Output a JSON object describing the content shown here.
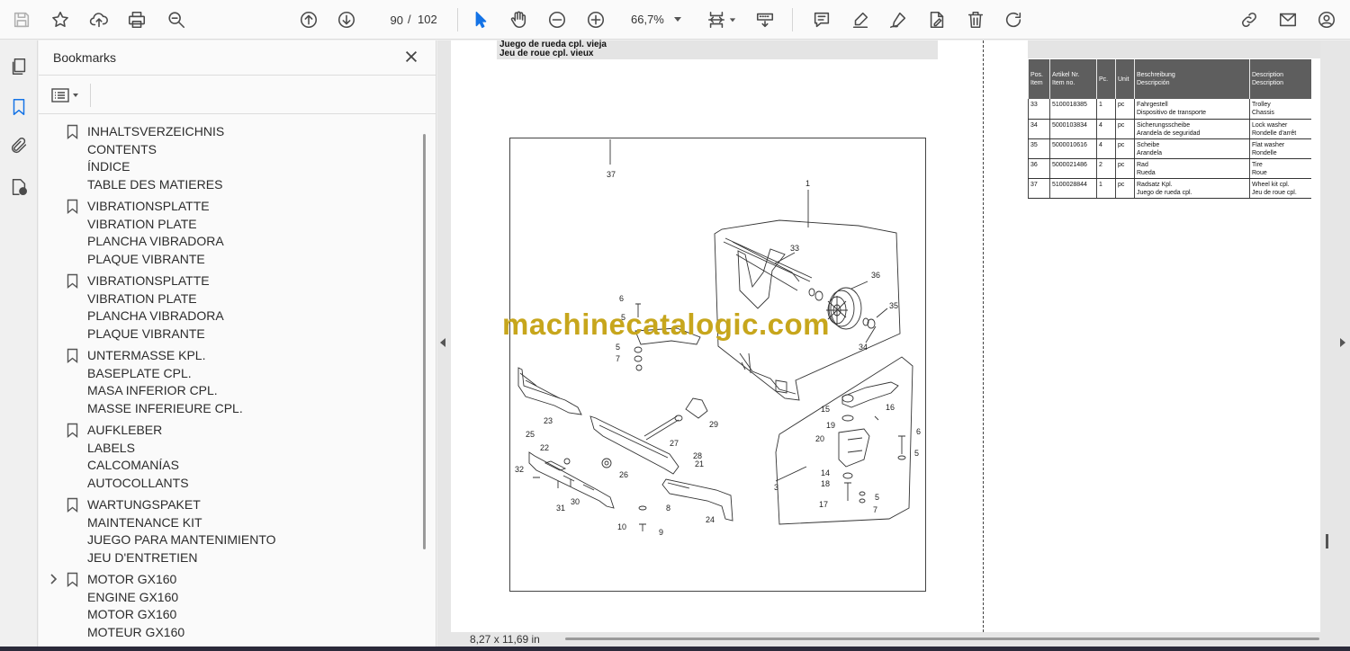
{
  "toolbar": {
    "page_current": "90",
    "page_separator": "/",
    "page_total": "102",
    "zoom": "66,7%"
  },
  "bookmarks": {
    "title": "Bookmarks",
    "groups": [
      {
        "lines": [
          "INHALTSVERZEICHNIS",
          "CONTENTS",
          "ÍNDICE",
          "TABLE DES MATIERES"
        ],
        "expandable": false
      },
      {
        "lines": [
          "VIBRATIONSPLATTE",
          "VIBRATION PLATE",
          "PLANCHA VIBRADORA",
          "PLAQUE VIBRANTE"
        ],
        "expandable": false
      },
      {
        "lines": [
          "VIBRATIONSPLATTE",
          "VIBRATION PLATE",
          "PLANCHA VIBRADORA",
          "PLAQUE VIBRANTE"
        ],
        "expandable": false
      },
      {
        "lines": [
          "UNTERMASSE KPL.",
          "BASEPLATE CPL.",
          "MASA INFERIOR CPL.",
          "MASSE INFERIEURE CPL."
        ],
        "expandable": false
      },
      {
        "lines": [
          "AUFKLEBER",
          "LABELS",
          "CALCOMANÍAS",
          "AUTOCOLLANTS"
        ],
        "expandable": false
      },
      {
        "lines": [
          "WARTUNGSPAKET",
          "MAINTENANCE KIT",
          "JUEGO PARA MANTENIMIENTO",
          "JEU D'ENTRETIEN"
        ],
        "expandable": false
      },
      {
        "lines": [
          "MOTOR GX160",
          "ENGINE GX160",
          "MOTOR GX160",
          "MOTEUR GX160"
        ],
        "expandable": true
      }
    ]
  },
  "document": {
    "header_line1": "Juego de rueda cpl. vieja",
    "header_line2": "Jeu de roue cpl. vieux",
    "watermark": "machinecatalogic.com",
    "page_size": "8,27 x 11,69 in",
    "diagram_labels": [
      "37",
      "1",
      "33",
      "36",
      "35",
      "34",
      "6",
      "5",
      "5",
      "7",
      "23",
      "25",
      "22",
      "32",
      "31",
      "30",
      "26",
      "21",
      "27",
      "28",
      "29",
      "8",
      "24",
      "10",
      "9",
      "3",
      "15",
      "19",
      "16",
      "20",
      "14",
      "18",
      "17",
      "6",
      "5",
      "5",
      "7"
    ],
    "parts_table": {
      "headers": [
        [
          "Pos.",
          "Item"
        ],
        [
          "Artikel Nr.",
          "Item no."
        ],
        [
          "Pc."
        ],
        [
          "Unit"
        ],
        [
          "Beschreibung",
          "Descripción"
        ],
        [
          "Description",
          "Description"
        ]
      ],
      "rows": [
        {
          "pos": "33",
          "item": "5100018385",
          "pc": "1",
          "unit": "pc",
          "desc1": "Fahrgestell",
          "desc2": "Dispositivo de transporte",
          "desc3": "Trolley",
          "desc4": "Chassis"
        },
        {
          "pos": "34",
          "item": "5000103834",
          "pc": "4",
          "unit": "pc",
          "desc1": "Sicherungsscheibe",
          "desc2": "Arandela de seguridad",
          "desc3": "Lock washer",
          "desc4": "Rondelle d'arrêt"
        },
        {
          "pos": "35",
          "item": "5000010616",
          "pc": "4",
          "unit": "pc",
          "desc1": "Scheibe",
          "desc2": "Arandela",
          "desc3": "Flat washer",
          "desc4": "Rondelle"
        },
        {
          "pos": "36",
          "item": "5000021486",
          "pc": "2",
          "unit": "pc",
          "desc1": "Rad",
          "desc2": "Rueda",
          "desc3": "Tire",
          "desc4": "Roue"
        },
        {
          "pos": "37",
          "item": "5100028844",
          "pc": "1",
          "unit": "pc",
          "desc1": "Radsatz Kpl.",
          "desc2": "Juego de rueda cpl.",
          "desc3": "Wheel kit cpl.",
          "desc4": "Jeu de roue cpl."
        }
      ]
    }
  },
  "icons": {
    "toolbar": [
      "save-icon",
      "star-icon",
      "upload-icon",
      "print-icon",
      "zoom-search-icon",
      "page-up-icon",
      "page-down-icon",
      "select-cursor-icon",
      "hand-icon",
      "zoom-out-icon",
      "zoom-in-icon",
      "page-fit-icon",
      "scroll-mode-icon",
      "comment-icon",
      "highlight-pen-icon",
      "draw-icon",
      "fill-sign-icon",
      "delete-icon",
      "rotate-icon",
      "link-icon",
      "mail-icon",
      "account-icon"
    ],
    "rail": [
      "pages-icon",
      "bookmark-icon",
      "attachment-icon",
      "properties-icon"
    ]
  }
}
